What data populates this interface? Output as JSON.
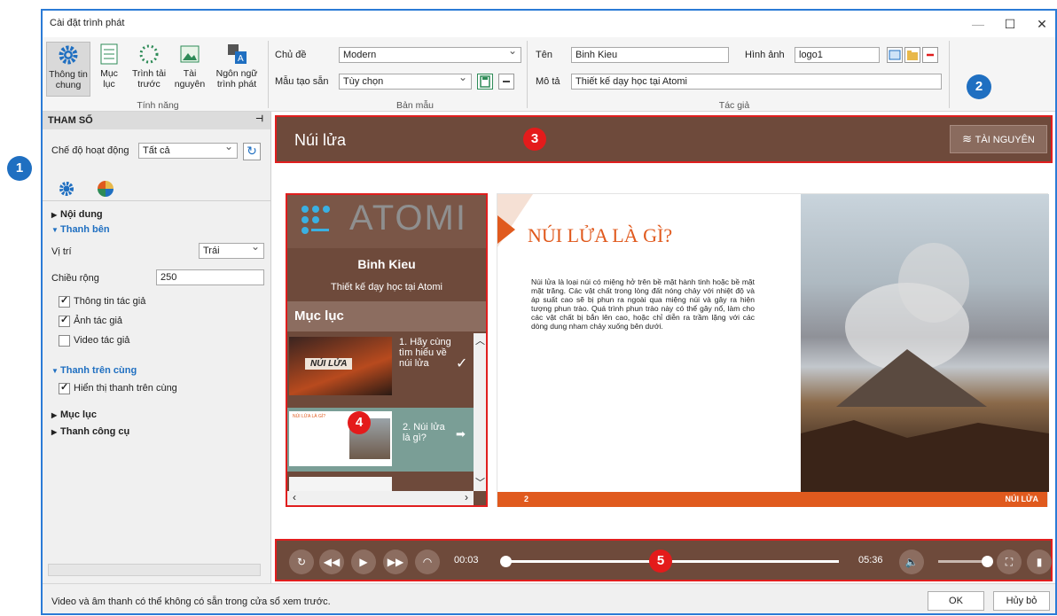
{
  "window": {
    "title": "Cài đặt trình phát"
  },
  "ribbon": {
    "buttons": [
      {
        "label": "Thông tin chung"
      },
      {
        "label": "Mục lục"
      },
      {
        "label": "Trình tải trước"
      },
      {
        "label": "Tài nguyên"
      },
      {
        "label": "Ngôn ngữ trình phát"
      }
    ],
    "group_features": "Tính năng",
    "theme_label": "Chủ đề",
    "theme_value": "Modern",
    "template_label": "Mẫu tạo sẵn",
    "template_value": "Tùy chọn",
    "group_template": "Bản mẫu",
    "name_label": "Tên",
    "name_value": "Binh Kieu",
    "image_label": "Hình ảnh",
    "image_value": "logo1",
    "desc_label": "Mô tả",
    "desc_value": "Thiết kế dạy học tại Atomi",
    "group_author": "Tác giả"
  },
  "params": {
    "header": "THAM SỐ",
    "mode_label": "Chế độ hoạt động",
    "mode_value": "Tất cả",
    "content": "Nội dung",
    "sidebar": "Thanh bên",
    "position_label": "Vị trí",
    "position_value": "Trái",
    "width_label": "Chiều rộng",
    "width_value": "250",
    "author_info": "Thông tin tác giả",
    "author_photo": "Ảnh tác giả",
    "author_video": "Video tác giả",
    "topbar": "Thanh trên cùng",
    "show_topbar": "Hiển thị thanh trên cùng",
    "toc": "Mục lục",
    "toolbar": "Thanh công cụ"
  },
  "preview": {
    "course_title": "Núi lửa",
    "resources_button": "TÀI NGUYÊN",
    "logo_text": "ATOMI",
    "author_name": "Binh Kieu",
    "author_desc": "Thiết kế dạy học tại Atomi",
    "toc_header": "Mục lục",
    "toc_items": [
      {
        "label": "1. Hãy cùng tìm hiểu về núi lửa",
        "thumb_text": "NÚI LỬA"
      },
      {
        "label": "2. Núi lửa là gì?",
        "thumb_text": "NÚI LỬA LÀ GÌ?"
      }
    ],
    "slide_title": "NÚI LỬA LÀ GÌ?",
    "slide_body": "Núi lửa là loại núi có miệng hở trên bề mặt hành tinh hoặc bề mặt mặt trăng. Các vật chất trong lòng đất nóng chảy với nhiệt độ và áp suất cao sẽ bị phun ra ngoài qua miệng núi và gây ra hiện tượng phun trào. Quá trình phun trào này có thể gây nổ, làm cho các vật chất bị bắn lên cao, hoặc chỉ diễn ra trầm lặng với các dòng dung nham chảy xuống bên dưới.",
    "slide_number": "2",
    "slide_footer": "NÚI LỬA",
    "time_current": "00:03",
    "time_total": "05:36",
    "progress": 0.0
  },
  "markers": [
    "1",
    "2",
    "3",
    "4",
    "5"
  ],
  "status": {
    "message": "Video và âm thanh có thể không có sẵn trong cửa sổ xem trước.",
    "ok": "OK",
    "cancel": "Hủy bỏ"
  },
  "colors": {
    "accent": "#1f6fc1",
    "brown": "#6e4a3b",
    "orange": "#e05a1e",
    "highlight": "#e01e1e"
  }
}
